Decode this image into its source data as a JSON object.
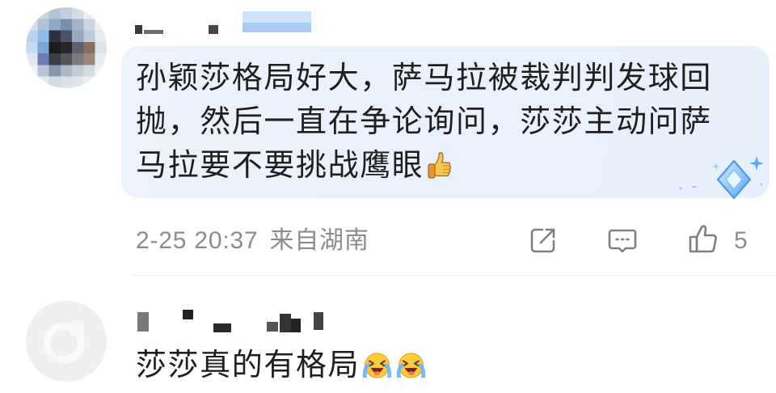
{
  "comments": [
    {
      "text": "孙颖莎格局好大，萨马拉被裁判判发球回抛，然后一直在争论询问，莎莎主动问萨马拉要不要挑战鹰眼",
      "emoji": [
        "thumbs-up"
      ],
      "timestamp": "2-25 20:37",
      "location": "来自湖南",
      "like_count": "5",
      "action_icons": [
        "share-icon",
        "comment-icon",
        "thumbs-up-icon"
      ],
      "decoration_icon": "diamond-badge-icon"
    },
    {
      "text": "莎莎真的有格局",
      "emoji": [
        "crying-laughing-face",
        "crying-laughing-face"
      ]
    }
  ],
  "theme": {
    "bubble_background": "#edf2fc",
    "text_color": "#1f1f1f",
    "meta_color": "#8c8c8c",
    "icon_color": "#808080",
    "divider_color": "#eeeeee",
    "badge_color": "#5aa9f2"
  }
}
